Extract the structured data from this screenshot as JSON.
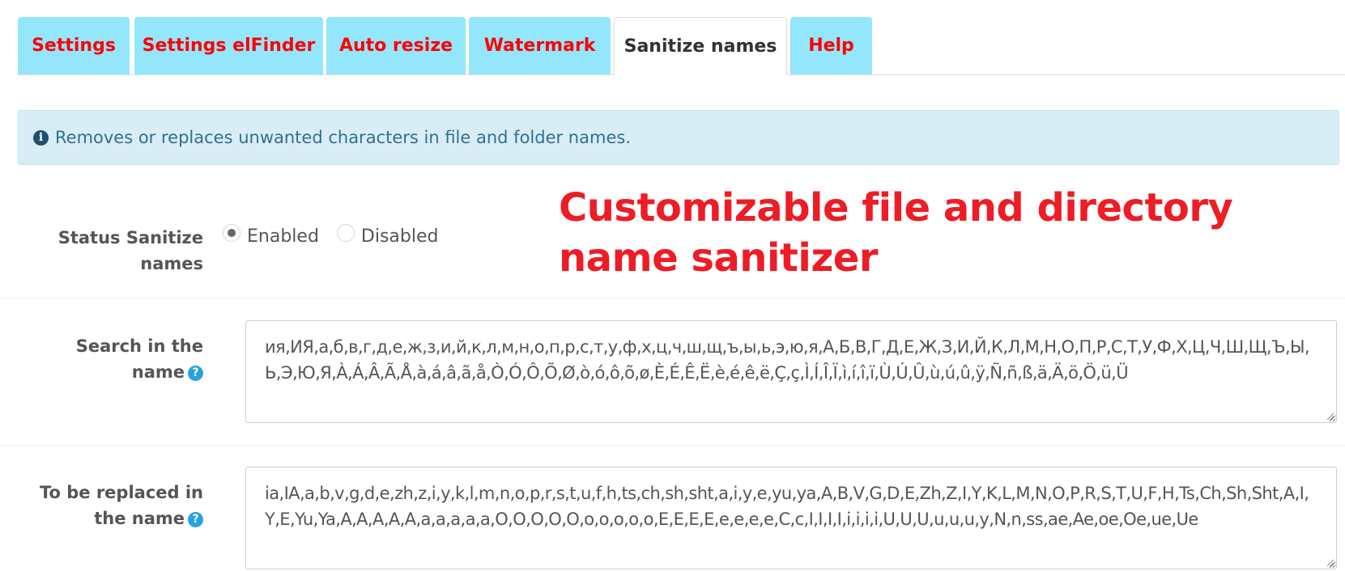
{
  "tabs": [
    {
      "label": "Settings",
      "active": false
    },
    {
      "label": "Settings elFinder",
      "active": false
    },
    {
      "label": "Auto resize",
      "active": false
    },
    {
      "label": "Watermark",
      "active": false
    },
    {
      "label": "Sanitize names",
      "active": true
    },
    {
      "label": "Help",
      "active": false
    }
  ],
  "alert": {
    "icon": "info-circle-icon",
    "text": "Removes or replaces unwanted characters in file and folder names."
  },
  "promo": {
    "text": "Customizable file and directory name sanitizer",
    "color": "#ee1c25"
  },
  "status": {
    "label": "Status Sanitize names",
    "options": [
      {
        "label": "Enabled",
        "checked": true
      },
      {
        "label": "Disabled",
        "checked": false
      }
    ]
  },
  "search": {
    "label": "Search in the name",
    "help_icon": "question-circle-icon",
    "value": "ия,ИЯ,а,б,в,г,д,е,ж,з,и,й,к,л,м,н,о,п,р,с,т,у,ф,х,ц,ч,ш,щ,ъ,ы,ь,э,ю,я,А,Б,В,Г,Д,Е,Ж,З,И,Й,К,Л,М,Н,О,П,Р,С,Т,У,Ф,Х,Ц,Ч,Ш,Щ,Ъ,Ы,Ь,Э,Ю,Я,À,Á,Â,Ã,Å,à,á,â,ã,å,Ò,Ó,Ô,Õ,Ø,ò,ó,ô,õ,ø,È,É,Ê,Ë,è,é,ê,ë,Ç,ç,Ì,Í,Î,Ï,ì,í,î,ï,Ù,Ú,Û,ù,ú,û,ÿ,Ñ,ñ,ß,ä,Ä,ö,Ö,ü,Ü"
  },
  "replace": {
    "label": "To be replaced in the name",
    "help_icon": "question-circle-icon",
    "value": "ia,IA,a,b,v,g,d,e,zh,z,i,y,k,l,m,n,o,p,r,s,t,u,f,h,ts,ch,sh,sht,a,i,y,e,yu,ya,A,B,V,G,D,E,Zh,Z,I,Y,K,L,M,N,O,P,R,S,T,U,F,H,Ts,Ch,Sh,Sht,A,I,Y,E,Yu,Ya,A,A,A,A,A,a,a,a,a,a,O,O,O,O,O,o,o,o,o,o,E,E,E,E,e,e,e,e,C,c,I,I,I,I,i,i,i,i,U,U,U,u,u,u,y,N,n,ss,ae,Ae,oe,Oe,ue,Ue"
  }
}
